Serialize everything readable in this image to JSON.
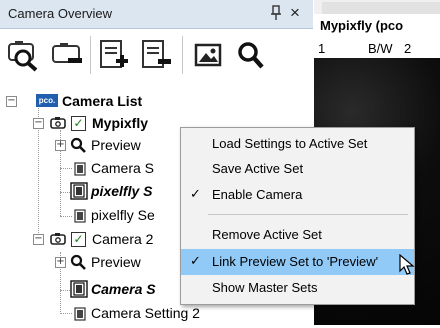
{
  "panel": {
    "title": "Camera Overview",
    "pin_glyph": "ꟷ",
    "close_glyph": "×"
  },
  "toolbar": {
    "icons": [
      "search-camera-icon",
      "remove-camera-icon",
      "add-set-icon",
      "remove-set-icon",
      "image-icon",
      "zoom-icon"
    ]
  },
  "tree": {
    "root": {
      "logo_text": "pco.",
      "label": "Camera List",
      "expander": "−"
    },
    "camera1": {
      "label": "Mypixfly",
      "checked": true,
      "expander": "−"
    },
    "preview1": {
      "label": "Preview",
      "expander": "+"
    },
    "set1a": {
      "label": "Camera S"
    },
    "set1b": {
      "label": "pixelfly S"
    },
    "set1c": {
      "label": "pixelfly Se"
    },
    "camera2": {
      "label": "Camera 2",
      "checked": true,
      "expander": "−"
    },
    "preview2": {
      "label": "Preview",
      "expander": "+"
    },
    "set2a": {
      "label": "Camera S"
    },
    "set2b": {
      "label": "Camera Setting 2"
    }
  },
  "viewer": {
    "title": "Mypixfly (pco",
    "index": "1",
    "mode": "B/W",
    "index2": "2"
  },
  "context_menu": {
    "items": [
      {
        "label": "Load Settings to Active Set",
        "checked": false
      },
      {
        "label": "Save Active Set",
        "checked": false
      },
      {
        "label": "Enable Camera",
        "checked": true
      },
      {
        "label": "Remove Active Set",
        "checked": false
      },
      {
        "label": "Link Preview Set to 'Preview'",
        "checked": true,
        "highlighted": true
      },
      {
        "label": "Show Master Sets",
        "checked": false
      }
    ],
    "check_glyph": "✓"
  },
  "colors": {
    "titlebar": "#dce6f1",
    "highlight": "#91c9f7",
    "check_green": "#1e7a1e",
    "pco_blue": "#1f5fae"
  }
}
